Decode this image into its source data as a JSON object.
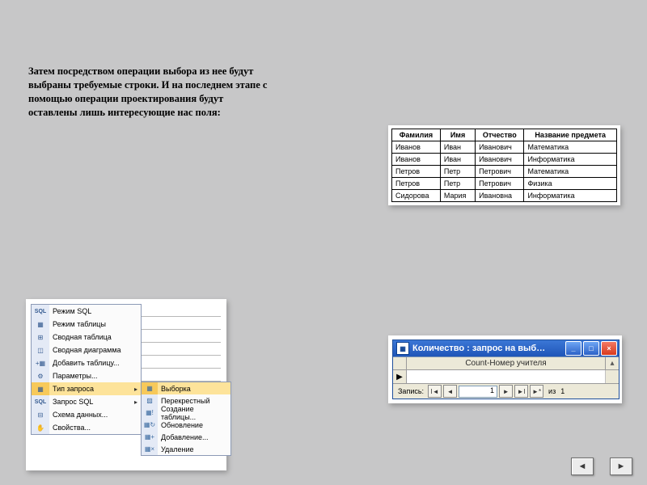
{
  "intro": "Затем посредством операции выбора из нее будут выбраны требуемые строки. И на последнем этапе с помощью операции проектирования будут оставлены лишь интересующие нас поля:",
  "table": {
    "headers": [
      "Фамилия",
      "Имя",
      "Отчество",
      "Название предмета"
    ],
    "rows": [
      [
        "Иванов",
        "Иван",
        "Иванович",
        "Математика"
      ],
      [
        "Иванов",
        "Иван",
        "Иванович",
        "Информатика"
      ],
      [
        "Петров",
        "Петр",
        "Петрович",
        "Математика"
      ],
      [
        "Петров",
        "Петр",
        "Петрович",
        "Физика"
      ],
      [
        "Сидорова",
        "Мария",
        "Ивановна",
        "Информатика"
      ]
    ]
  },
  "menu1": {
    "items": [
      {
        "icon": "SQL",
        "label": "Режим SQL"
      },
      {
        "icon": "▦",
        "label": "Режим таблицы"
      },
      {
        "icon": "⊞",
        "label": "Сводная таблица"
      },
      {
        "icon": "◫",
        "label": "Сводная диаграмма"
      },
      {
        "icon": "+▦",
        "label": "Добавить таблицу..."
      },
      {
        "icon": "⚙",
        "label": "Параметры..."
      },
      {
        "icon": "▦",
        "label": "Тип запроса",
        "arrow": "▸",
        "hl": true
      },
      {
        "icon": "SQL",
        "label": "Запрос SQL",
        "arrow": "▸"
      },
      {
        "icon": "⊟",
        "label": "Схема данных..."
      },
      {
        "icon": "✋",
        "label": "Свойства..."
      }
    ]
  },
  "menu2": {
    "items": [
      {
        "icon": "▦",
        "label": "Выборка",
        "hl": true
      },
      {
        "icon": "▨",
        "label": "Перекрестный"
      },
      {
        "icon": "▦!",
        "label": "Создание таблицы..."
      },
      {
        "icon": "▦↻",
        "label": "Обновление"
      },
      {
        "icon": "▦+",
        "label": "Добавление..."
      },
      {
        "icon": "▦×",
        "label": "Удаление"
      }
    ]
  },
  "qwin": {
    "title": "Количество : запрос на выб…",
    "column": "Count-Номер учителя",
    "value": "",
    "nav": {
      "label": "Запись:",
      "num": "1",
      "of_label": "из",
      "total": "1"
    },
    "btn": {
      "min": "_",
      "max": "□",
      "close": "×"
    }
  },
  "slide_nav": {
    "prev": "◄",
    "next": "►"
  }
}
